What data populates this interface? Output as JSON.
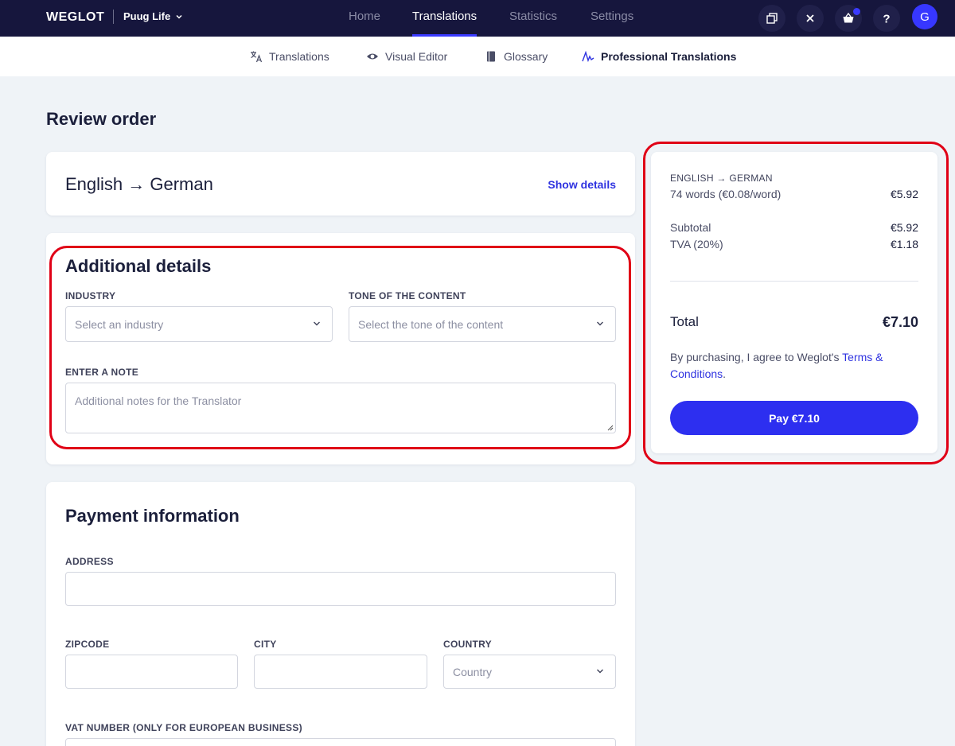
{
  "app": {
    "logo": "WEGLOT",
    "project": "Puug Life"
  },
  "main_nav": [
    {
      "label": "Home"
    },
    {
      "label": "Translations"
    },
    {
      "label": "Statistics"
    },
    {
      "label": "Settings"
    }
  ],
  "active_main_nav": "Translations",
  "header_icons": [
    "copy-icon",
    "close-icon",
    "basket-icon",
    "help-icon"
  ],
  "user": {
    "initial": "G"
  },
  "sub_nav": [
    {
      "label": "Translations",
      "icon": "translate-icon"
    },
    {
      "label": "Visual Editor",
      "icon": "eye-icon"
    },
    {
      "label": "Glossary",
      "icon": "book-icon"
    },
    {
      "label": "Professional Translations",
      "icon": "signature-icon"
    }
  ],
  "page": {
    "title": "Review order"
  },
  "language_card": {
    "pair": "English → German",
    "show_details": "Show details"
  },
  "additional_details": {
    "title": "Additional details",
    "industry_label": "INDUSTRY",
    "industry_placeholder": "Select an industry",
    "tone_label": "TONE OF THE CONTENT",
    "tone_placeholder": "Select the tone of the content",
    "note_label": "ENTER A NOTE",
    "note_placeholder": "Additional notes for the Translator"
  },
  "payment": {
    "title": "Payment information",
    "address_label": "ADDRESS",
    "zipcode_label": "ZIPCODE",
    "city_label": "CITY",
    "country_label": "COUNTRY",
    "country_placeholder": "Country",
    "vat_label": "VAT NUMBER (ONLY FOR EUROPEAN BUSINESS)"
  },
  "summary": {
    "pair_label": "ENGLISH → GERMAN",
    "words_label": "74 words (€0.08/word)",
    "words_value": "€5.92",
    "subtotal_label": "Subtotal",
    "subtotal_value": "€5.92",
    "tax_label": "TVA (20%)",
    "tax_value": "€1.18",
    "total_label": "Total",
    "total_value": "€7.10",
    "legal_prefix": "By purchasing, I agree to Weglot's ",
    "legal_link": "Terms & Conditions",
    "legal_suffix": ".",
    "pay_button": "Pay €7.10"
  },
  "colors": {
    "topbar": "#16163d",
    "accent": "#2d2ff0",
    "highlight": "#e00016"
  }
}
